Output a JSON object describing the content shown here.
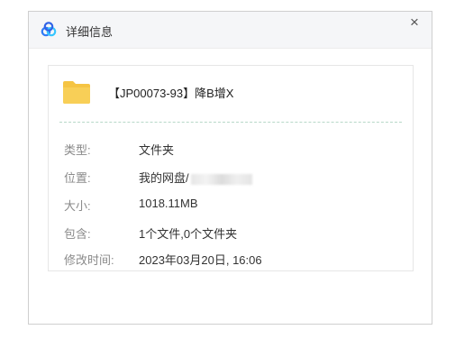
{
  "dialog": {
    "title": "详细信息",
    "close_glyph": "×",
    "icons": {
      "app": "baidu-netdisk-logo-icon",
      "close": "close-icon"
    }
  },
  "file": {
    "name": "【JP00073-93】降B增X",
    "icon": "folder-icon",
    "colors": {
      "folder": "#f5c443",
      "divider": "#b7d8c8"
    }
  },
  "details": [
    {
      "label": "类型:",
      "value": "文件夹"
    },
    {
      "label": "位置:",
      "value": "我的网盘/"
    },
    {
      "label": "大小:",
      "value": "1018.11MB"
    },
    {
      "label": "包含:",
      "value": "1个文件,0个文件夹"
    },
    {
      "label": "修改时间:",
      "value": "2023年03月20日, 16:06"
    }
  ]
}
